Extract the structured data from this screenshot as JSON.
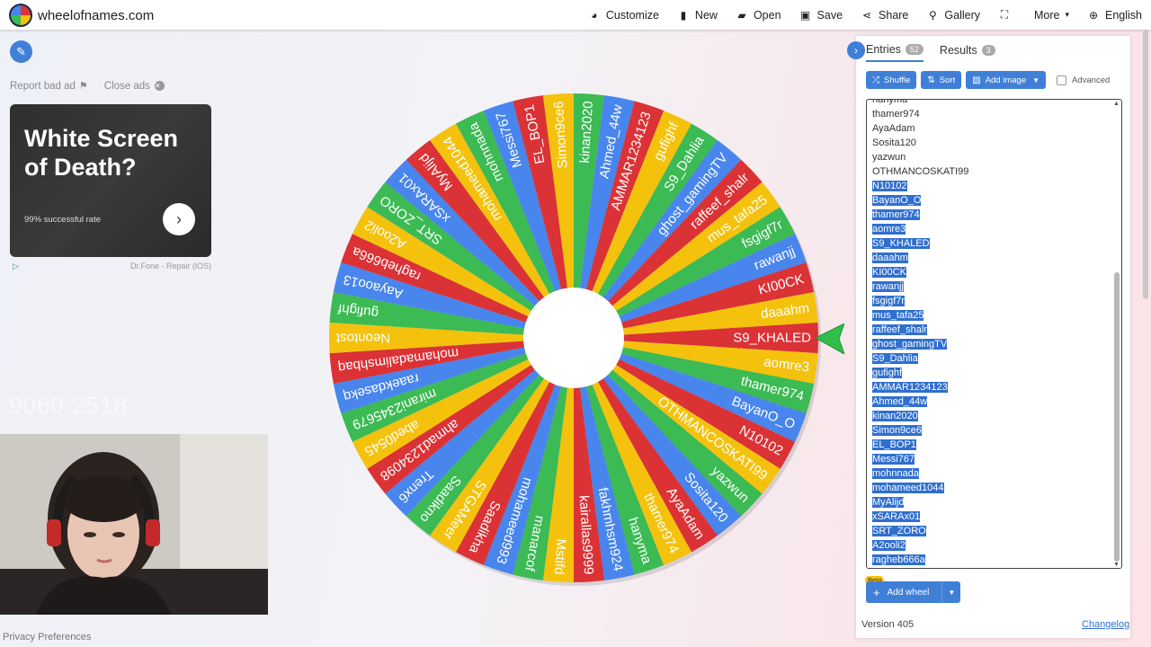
{
  "brand": {
    "name": "wheelofnames.com"
  },
  "menu": [
    {
      "label": "Customize",
      "icon": "palette-icon",
      "glyph": "◕"
    },
    {
      "label": "New",
      "icon": "file-icon",
      "glyph": "▮"
    },
    {
      "label": "Open",
      "icon": "folder-open-icon",
      "glyph": "▰"
    },
    {
      "label": "Save",
      "icon": "save-icon",
      "glyph": "▣"
    },
    {
      "label": "Share",
      "icon": "share-icon",
      "glyph": "⋖"
    },
    {
      "label": "Gallery",
      "icon": "search-icon",
      "glyph": "⚲"
    },
    {
      "label": "",
      "icon": "fullscreen-icon",
      "glyph": "⛶"
    },
    {
      "label": "More",
      "icon": "",
      "glyph": "",
      "caret": "▾"
    },
    {
      "label": "English",
      "icon": "globe-icon",
      "glyph": "⊕"
    }
  ],
  "ad": {
    "report": "Report bad ad",
    "close": "Close ads",
    "title": "White Screen of Death?",
    "rate": "99% successful rate",
    "source": "Dr.Fone - Repair (iOS)"
  },
  "faint_text": "9060 2518",
  "privacy": "Privacy Preferences",
  "tabs": {
    "entries_label": "Entries",
    "entries_count": "52",
    "results_label": "Results",
    "results_count": "3"
  },
  "toolbar": {
    "shuffle": "Shuffle",
    "sort": "Sort",
    "add_image": "Add image",
    "advanced": "Advanced"
  },
  "entries_visible": [
    {
      "text": "hanyma",
      "selected": false
    },
    {
      "text": "thamer974",
      "selected": false
    },
    {
      "text": "AyaAdam",
      "selected": false
    },
    {
      "text": "Sosita120",
      "selected": false
    },
    {
      "text": "yazwun",
      "selected": false
    },
    {
      "text": "OTHMANCOSKATI99",
      "selected": false
    },
    {
      "text": "N10102",
      "selected": true
    },
    {
      "text": "BayanO_O",
      "selected": true
    },
    {
      "text": "thamer974",
      "selected": true
    },
    {
      "text": "aomre3",
      "selected": true
    },
    {
      "text": "S9_KHALED",
      "selected": true
    },
    {
      "text": "daaahm",
      "selected": true
    },
    {
      "text": "KI00CK",
      "selected": true
    },
    {
      "text": "rawanjj",
      "selected": true
    },
    {
      "text": "fsgigf7r",
      "selected": true
    },
    {
      "text": "mus_tafa25",
      "selected": true
    },
    {
      "text": "raffeef_shalr",
      "selected": true
    },
    {
      "text": "ghost_gamingTV",
      "selected": true
    },
    {
      "text": "S9_Dahlia",
      "selected": true
    },
    {
      "text": "gufighf",
      "selected": true
    },
    {
      "text": "AMMAR1234123",
      "selected": true
    },
    {
      "text": "Ahmed_44w",
      "selected": true
    },
    {
      "text": "kinan2020",
      "selected": true
    },
    {
      "text": "Simon9ce6",
      "selected": true
    },
    {
      "text": "EL_BOP1",
      "selected": true
    },
    {
      "text": "Messi767",
      "selected": true
    },
    {
      "text": "mohnnada",
      "selected": true
    },
    {
      "text": "mohameed1044",
      "selected": true
    },
    {
      "text": "MyAlijd",
      "selected": true
    },
    {
      "text": "xSARAx01",
      "selected": true
    },
    {
      "text": "SRT_ZORO",
      "selected": true
    },
    {
      "text": "A2ooli2",
      "selected": true
    },
    {
      "text": "ragheb666a",
      "selected": true
    }
  ],
  "wheel": {
    "colors": [
      "#db3236",
      "#f4c20d",
      "#3cba54",
      "#4885ed"
    ],
    "text_color": "#ffffff",
    "labels": [
      "S9_KHALED",
      "aomre3",
      "thamer974",
      "BayanO_O",
      "N10102",
      "OTHMANCOSKATI99",
      "yazwun",
      "Sosita120",
      "AyaAdam",
      "thamer974",
      "hanyma",
      "fakhmhsm924",
      "kairallas9999",
      "Mstifd",
      "manarcof",
      "mohameed993",
      "Saadikha",
      "STGAMeer",
      "Saadikno",
      "Trenx6",
      "ahmad1234098",
      "abed0545",
      "mirani2345679",
      "raaekdasekq",
      "mohamadalimshbaq",
      "Neontost",
      "gufighf",
      "Aayaoo13",
      "ragheb666a",
      "A2ooli2",
      "SRT_ZORO",
      "xSARAx01",
      "MyAlijd",
      "mohameed1044",
      "mohnnada",
      "Messi767",
      "EL_BOP1",
      "Simon9ce6",
      "kinan2020",
      "Ahmed_44w",
      "AMMAR1234123",
      "gufighf",
      "S9_Dahlia",
      "ghost_gamingTV",
      "raffeef_shalr",
      "mus_tafa25",
      "fsgigf7r",
      "rawanjj",
      "KI00CK",
      "daaahm"
    ]
  },
  "add_wheel": {
    "label": "Add wheel",
    "beta": "Beta"
  },
  "footer": {
    "version": "Version 405",
    "changelog": "Changelog"
  }
}
